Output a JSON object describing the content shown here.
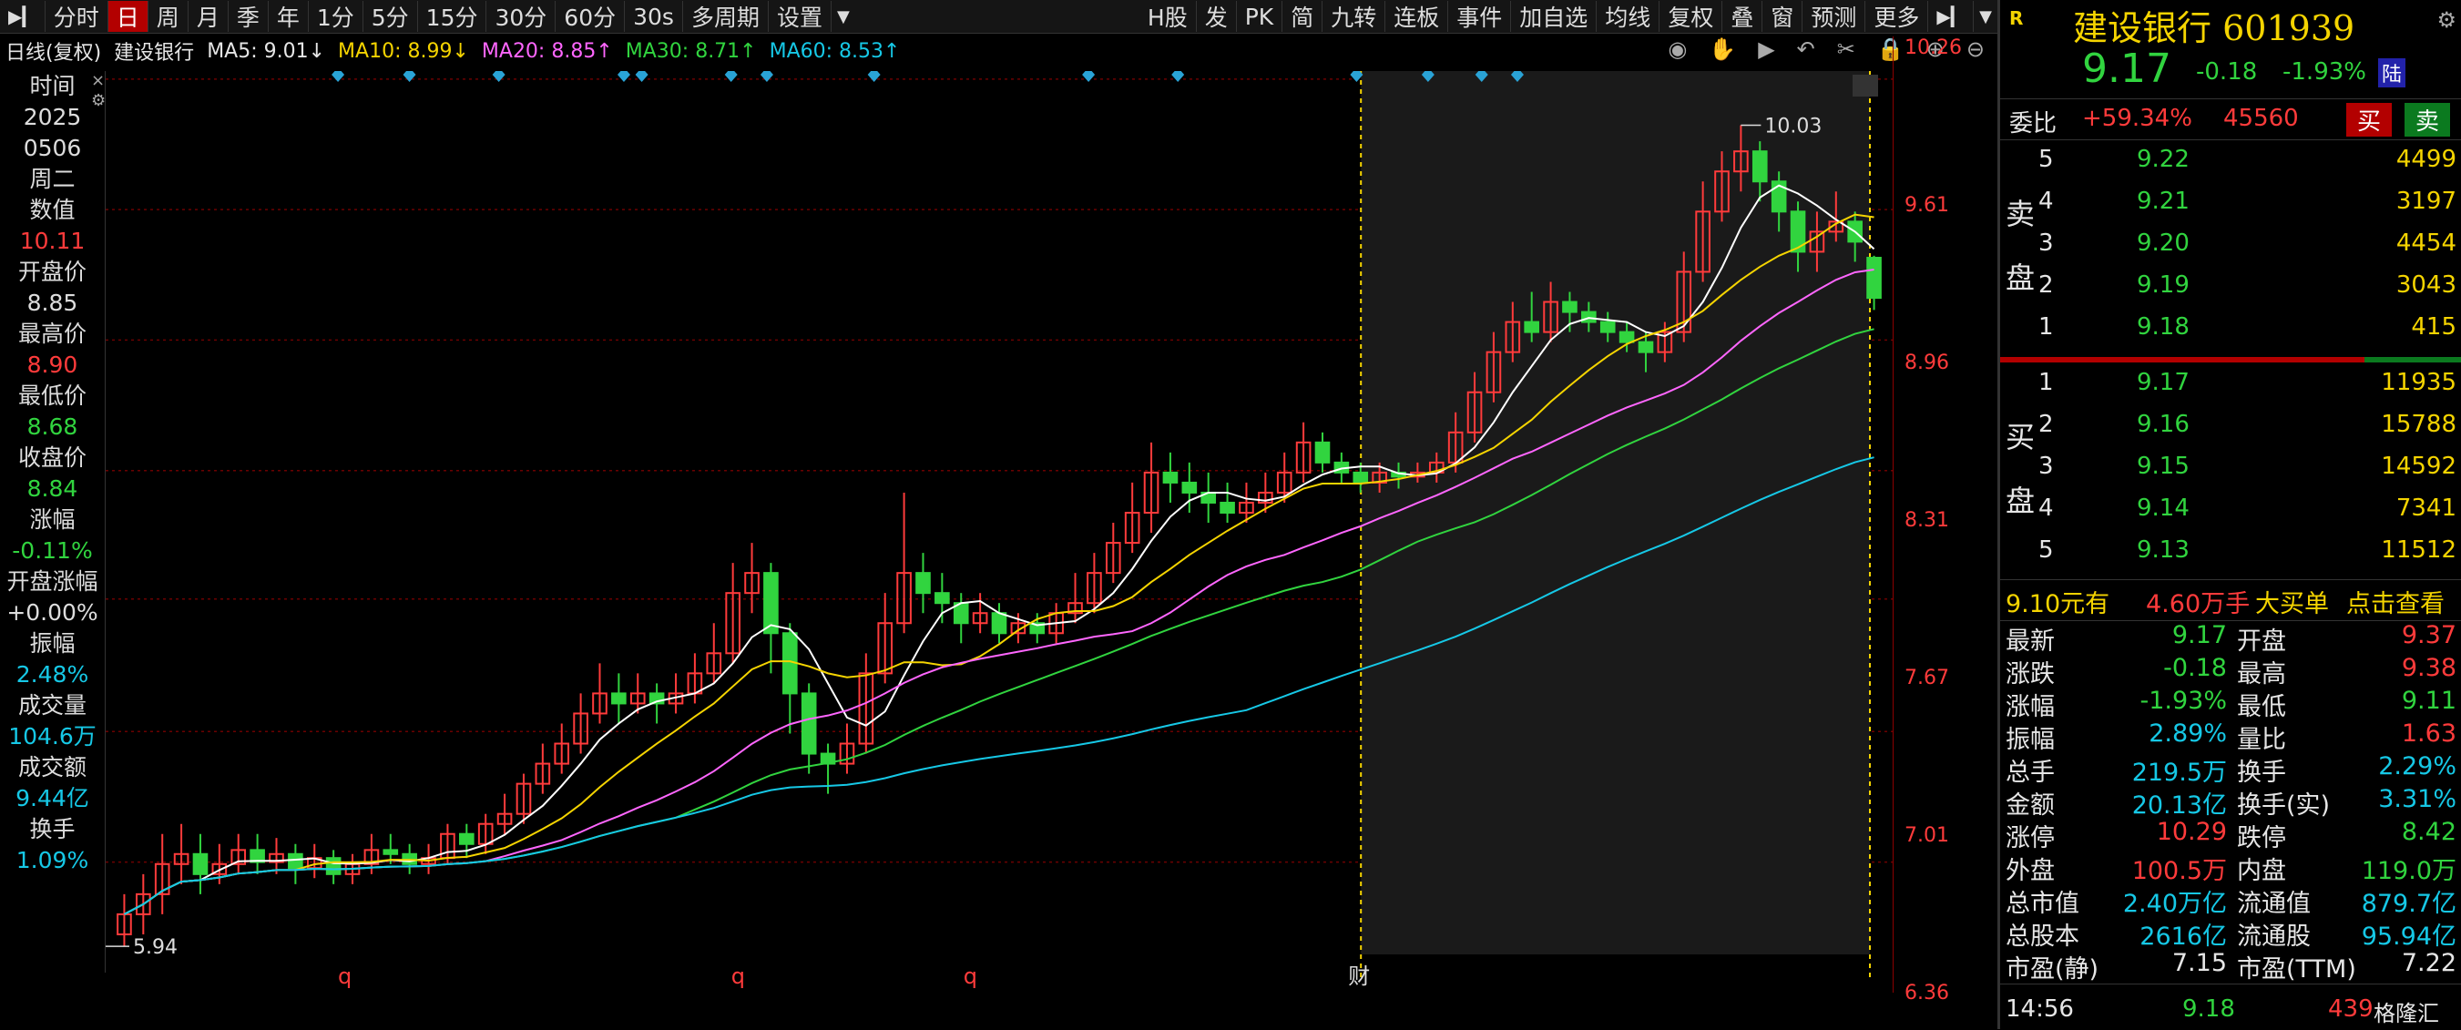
{
  "toolbar": {
    "tabs": [
      "分时",
      "日",
      "周",
      "月",
      "季",
      "年",
      "1分",
      "5分",
      "15分",
      "30分",
      "60分",
      "30s",
      "多周期",
      "设置"
    ],
    "active_tab": "日",
    "right_buttons": [
      "H股",
      "发",
      "PK",
      "简",
      "九转",
      "连板",
      "事件",
      "加自选",
      "均线",
      "复权",
      "叠",
      "窗",
      "预测",
      "更多"
    ]
  },
  "indicator": {
    "title": "日线(复权)",
    "stock": "建设银行",
    "ma5": "MA5: 9.01↓",
    "ma10": "MA10: 8.99↓",
    "ma20": "MA20: 8.85↑",
    "ma30": "MA30: 8.71↑",
    "ma60": "MA60: 8.53↑"
  },
  "left_info": [
    {
      "label": "时间",
      "value": "2025",
      "color": "#ddd"
    },
    {
      "label": "",
      "value": "0506",
      "color": "#ddd"
    },
    {
      "label": "周二",
      "value": "",
      "color": "#ddd"
    },
    {
      "label": "数值",
      "value": "10.11",
      "color": "#ff3b3b"
    },
    {
      "label": "开盘价",
      "value": "8.85",
      "color": "#ddd"
    },
    {
      "label": "最高价",
      "value": "8.90",
      "color": "#ff3b3b"
    },
    {
      "label": "最低价",
      "value": "8.68",
      "color": "#31d43f"
    },
    {
      "label": "收盘价",
      "value": "8.84",
      "color": "#31d43f"
    },
    {
      "label": "涨幅",
      "value": "-0.11%",
      "color": "#31d43f"
    },
    {
      "label": "开盘涨幅",
      "value": "+0.00%",
      "color": "#ddd"
    },
    {
      "label": "振幅",
      "value": "2.48%",
      "color": "#16c8e6"
    },
    {
      "label": "成交量",
      "value": "104.6万",
      "color": "#16c8e6"
    },
    {
      "label": "成交额",
      "value": "9.44亿",
      "color": "#16c8e6"
    },
    {
      "label": "换手",
      "value": "1.09%",
      "color": "#16c8e6"
    }
  ],
  "price_axis": [
    "10.26",
    "9.61",
    "8.96",
    "8.31",
    "7.67",
    "7.01",
    "6.36"
  ],
  "annotations": {
    "high": "10.03",
    "low": "5.94",
    "marker_q": "q",
    "marker_cai": "财"
  },
  "right_panel": {
    "name": "建设银行",
    "code": "601939",
    "price": "9.17",
    "change": "-0.18",
    "change_pct": "-1.93%",
    "market_tag": "陆",
    "r_tag": "R",
    "weibi_label": "委比",
    "weibi_pct": "+59.34%",
    "weibi_val": "45560",
    "buy_btn": "买",
    "sell_btn": "卖",
    "sell_label": [
      "卖",
      "盘"
    ],
    "buy_label": [
      "买",
      "盘"
    ],
    "asks": [
      {
        "lvl": "5",
        "price": "9.22",
        "vol": "4499"
      },
      {
        "lvl": "4",
        "price": "9.21",
        "vol": "3197"
      },
      {
        "lvl": "3",
        "price": "9.20",
        "vol": "4454"
      },
      {
        "lvl": "2",
        "price": "9.19",
        "vol": "3043"
      },
      {
        "lvl": "1",
        "price": "9.18",
        "vol": "415"
      }
    ],
    "bids": [
      {
        "lvl": "1",
        "price": "9.17",
        "vol": "11935"
      },
      {
        "lvl": "2",
        "price": "9.16",
        "vol": "15788"
      },
      {
        "lvl": "3",
        "price": "9.15",
        "vol": "14592"
      },
      {
        "lvl": "4",
        "price": "9.14",
        "vol": "7341"
      },
      {
        "lvl": "5",
        "price": "9.13",
        "vol": "11512"
      }
    ],
    "bigorder": {
      "price": "9.10元有",
      "amount": "4.60万手",
      "label": "大买单",
      "link": "点击查看"
    },
    "stats": [
      [
        "最新",
        "9.17",
        "#31d43f",
        "开盘",
        "9.37",
        "#ff3b3b"
      ],
      [
        "涨跌",
        "-0.18",
        "#31d43f",
        "最高",
        "9.38",
        "#ff3b3b"
      ],
      [
        "涨幅",
        "-1.93%",
        "#31d43f",
        "最低",
        "9.11",
        "#31d43f"
      ],
      [
        "振幅",
        "2.89%",
        "#16c8e6",
        "量比",
        "1.63",
        "#ff3b3b"
      ],
      [
        "总手",
        "219.5万",
        "#16c8e6",
        "换手",
        "2.29%",
        "#16c8e6"
      ],
      [
        "金额",
        "20.13亿",
        "#16c8e6",
        "换手(实)",
        "3.31%",
        "#16c8e6"
      ],
      [
        "涨停",
        "10.29",
        "#ff3b3b",
        "跌停",
        "8.42",
        "#31d43f"
      ],
      [
        "外盘",
        "100.5万",
        "#ff3b3b",
        "内盘",
        "119.0万",
        "#31d43f"
      ],
      [
        "总市值",
        "2.40万亿",
        "#16c8e6",
        "流通值",
        "879.7亿",
        "#16c8e6"
      ],
      [
        "总股本",
        "2616亿",
        "#16c8e6",
        "流通股",
        "95.94亿",
        "#16c8e6"
      ],
      [
        "市盈(静)",
        "7.15",
        "#e6e6e6",
        "市盈(TTM)",
        "7.22",
        "#e6e6e6"
      ]
    ],
    "tick": {
      "time": "14:56",
      "price": "9.18",
      "vol": "439",
      "logo": "格隆汇"
    }
  },
  "chart_data": {
    "type": "candlestick",
    "title": "建设银行 日线(复权)",
    "ylim": [
      5.9,
      10.3
    ],
    "candles": [
      [
        6.0,
        6.1,
        6.2,
        5.94
      ],
      [
        6.1,
        6.2,
        6.3,
        6.0
      ],
      [
        6.2,
        6.35,
        6.5,
        6.1
      ],
      [
        6.35,
        6.4,
        6.55,
        6.25
      ],
      [
        6.4,
        6.3,
        6.5,
        6.2
      ],
      [
        6.3,
        6.35,
        6.45,
        6.25
      ],
      [
        6.35,
        6.42,
        6.5,
        6.3
      ],
      [
        6.42,
        6.36,
        6.5,
        6.3
      ],
      [
        6.36,
        6.4,
        6.48,
        6.3
      ],
      [
        6.4,
        6.33,
        6.45,
        6.25
      ],
      [
        6.33,
        6.38,
        6.45,
        6.28
      ],
      [
        6.38,
        6.3,
        6.42,
        6.25
      ],
      [
        6.3,
        6.35,
        6.4,
        6.25
      ],
      [
        6.35,
        6.42,
        6.5,
        6.3
      ],
      [
        6.42,
        6.4,
        6.5,
        6.35
      ],
      [
        6.4,
        6.35,
        6.45,
        6.3
      ],
      [
        6.35,
        6.38,
        6.45,
        6.3
      ],
      [
        6.38,
        6.5,
        6.55,
        6.35
      ],
      [
        6.5,
        6.45,
        6.55,
        6.38
      ],
      [
        6.45,
        6.55,
        6.6,
        6.4
      ],
      [
        6.55,
        6.6,
        6.7,
        6.5
      ],
      [
        6.6,
        6.75,
        6.8,
        6.55
      ],
      [
        6.75,
        6.85,
        6.95,
        6.7
      ],
      [
        6.85,
        6.95,
        7.05,
        6.8
      ],
      [
        6.95,
        7.1,
        7.2,
        6.9
      ],
      [
        7.1,
        7.2,
        7.35,
        7.05
      ],
      [
        7.2,
        7.15,
        7.3,
        7.05
      ],
      [
        7.15,
        7.2,
        7.3,
        7.1
      ],
      [
        7.2,
        7.15,
        7.25,
        7.05
      ],
      [
        7.15,
        7.2,
        7.3,
        7.1
      ],
      [
        7.2,
        7.3,
        7.4,
        7.15
      ],
      [
        7.3,
        7.4,
        7.55,
        7.25
      ],
      [
        7.4,
        7.7,
        7.85,
        7.35
      ],
      [
        7.7,
        7.8,
        7.95,
        7.6
      ],
      [
        7.8,
        7.5,
        7.85,
        7.3
      ],
      [
        7.5,
        7.2,
        7.55,
        7.0
      ],
      [
        7.2,
        6.9,
        7.25,
        6.8
      ],
      [
        6.9,
        6.85,
        6.95,
        6.7
      ],
      [
        6.85,
        6.95,
        7.05,
        6.8
      ],
      [
        6.95,
        7.3,
        7.4,
        6.9
      ],
      [
        7.3,
        7.55,
        7.7,
        7.25
      ],
      [
        7.55,
        7.8,
        8.2,
        7.5
      ],
      [
        7.8,
        7.7,
        7.9,
        7.6
      ],
      [
        7.7,
        7.65,
        7.8,
        7.55
      ],
      [
        7.65,
        7.55,
        7.7,
        7.45
      ],
      [
        7.55,
        7.6,
        7.7,
        7.5
      ],
      [
        7.6,
        7.5,
        7.65,
        7.45
      ],
      [
        7.5,
        7.55,
        7.6,
        7.45
      ],
      [
        7.55,
        7.5,
        7.6,
        7.45
      ],
      [
        7.5,
        7.6,
        7.65,
        7.45
      ],
      [
        7.6,
        7.65,
        7.8,
        7.55
      ],
      [
        7.65,
        7.8,
        7.9,
        7.6
      ],
      [
        7.8,
        7.95,
        8.05,
        7.75
      ],
      [
        7.95,
        8.1,
        8.25,
        7.9
      ],
      [
        8.1,
        8.3,
        8.45,
        8.0
      ],
      [
        8.3,
        8.25,
        8.4,
        8.15
      ],
      [
        8.25,
        8.2,
        8.35,
        8.1
      ],
      [
        8.2,
        8.15,
        8.3,
        8.05
      ],
      [
        8.15,
        8.1,
        8.25,
        8.05
      ],
      [
        8.1,
        8.15,
        8.25,
        8.05
      ],
      [
        8.15,
        8.2,
        8.3,
        8.1
      ],
      [
        8.2,
        8.3,
        8.4,
        8.15
      ],
      [
        8.3,
        8.45,
        8.55,
        8.25
      ],
      [
        8.45,
        8.35,
        8.5,
        8.3
      ],
      [
        8.35,
        8.3,
        8.4,
        8.25
      ],
      [
        8.3,
        8.25,
        8.35,
        8.2
      ],
      [
        8.25,
        8.3,
        8.35,
        8.2
      ],
      [
        8.3,
        8.28,
        8.35,
        8.22
      ],
      [
        8.28,
        8.3,
        8.35,
        8.25
      ],
      [
        8.3,
        8.35,
        8.4,
        8.25
      ],
      [
        8.35,
        8.5,
        8.6,
        8.3
      ],
      [
        8.5,
        8.7,
        8.8,
        8.45
      ],
      [
        8.7,
        8.9,
        9.0,
        8.65
      ],
      [
        8.9,
        9.05,
        9.15,
        8.85
      ],
      [
        9.05,
        9.0,
        9.2,
        8.95
      ],
      [
        9.0,
        9.15,
        9.25,
        8.95
      ],
      [
        9.15,
        9.1,
        9.2,
        9.0
      ],
      [
        9.1,
        9.05,
        9.15,
        9.0
      ],
      [
        9.05,
        9.0,
        9.1,
        8.95
      ],
      [
        9.0,
        8.95,
        9.05,
        8.9
      ],
      [
        8.95,
        8.9,
        9.0,
        8.8
      ],
      [
        8.9,
        9.0,
        9.05,
        8.85
      ],
      [
        9.0,
        9.3,
        9.4,
        8.95
      ],
      [
        9.3,
        9.6,
        9.75,
        9.25
      ],
      [
        9.6,
        9.8,
        9.9,
        9.55
      ],
      [
        9.8,
        9.9,
        10.03,
        9.7
      ],
      [
        9.9,
        9.75,
        9.95,
        9.65
      ],
      [
        9.75,
        9.6,
        9.8,
        9.5
      ],
      [
        9.6,
        9.4,
        9.65,
        9.3
      ],
      [
        9.4,
        9.5,
        9.6,
        9.3
      ],
      [
        9.5,
        9.55,
        9.7,
        9.45
      ],
      [
        9.55,
        9.45,
        9.6,
        9.35
      ],
      [
        9.37,
        9.17,
        9.38,
        9.11
      ]
    ]
  }
}
